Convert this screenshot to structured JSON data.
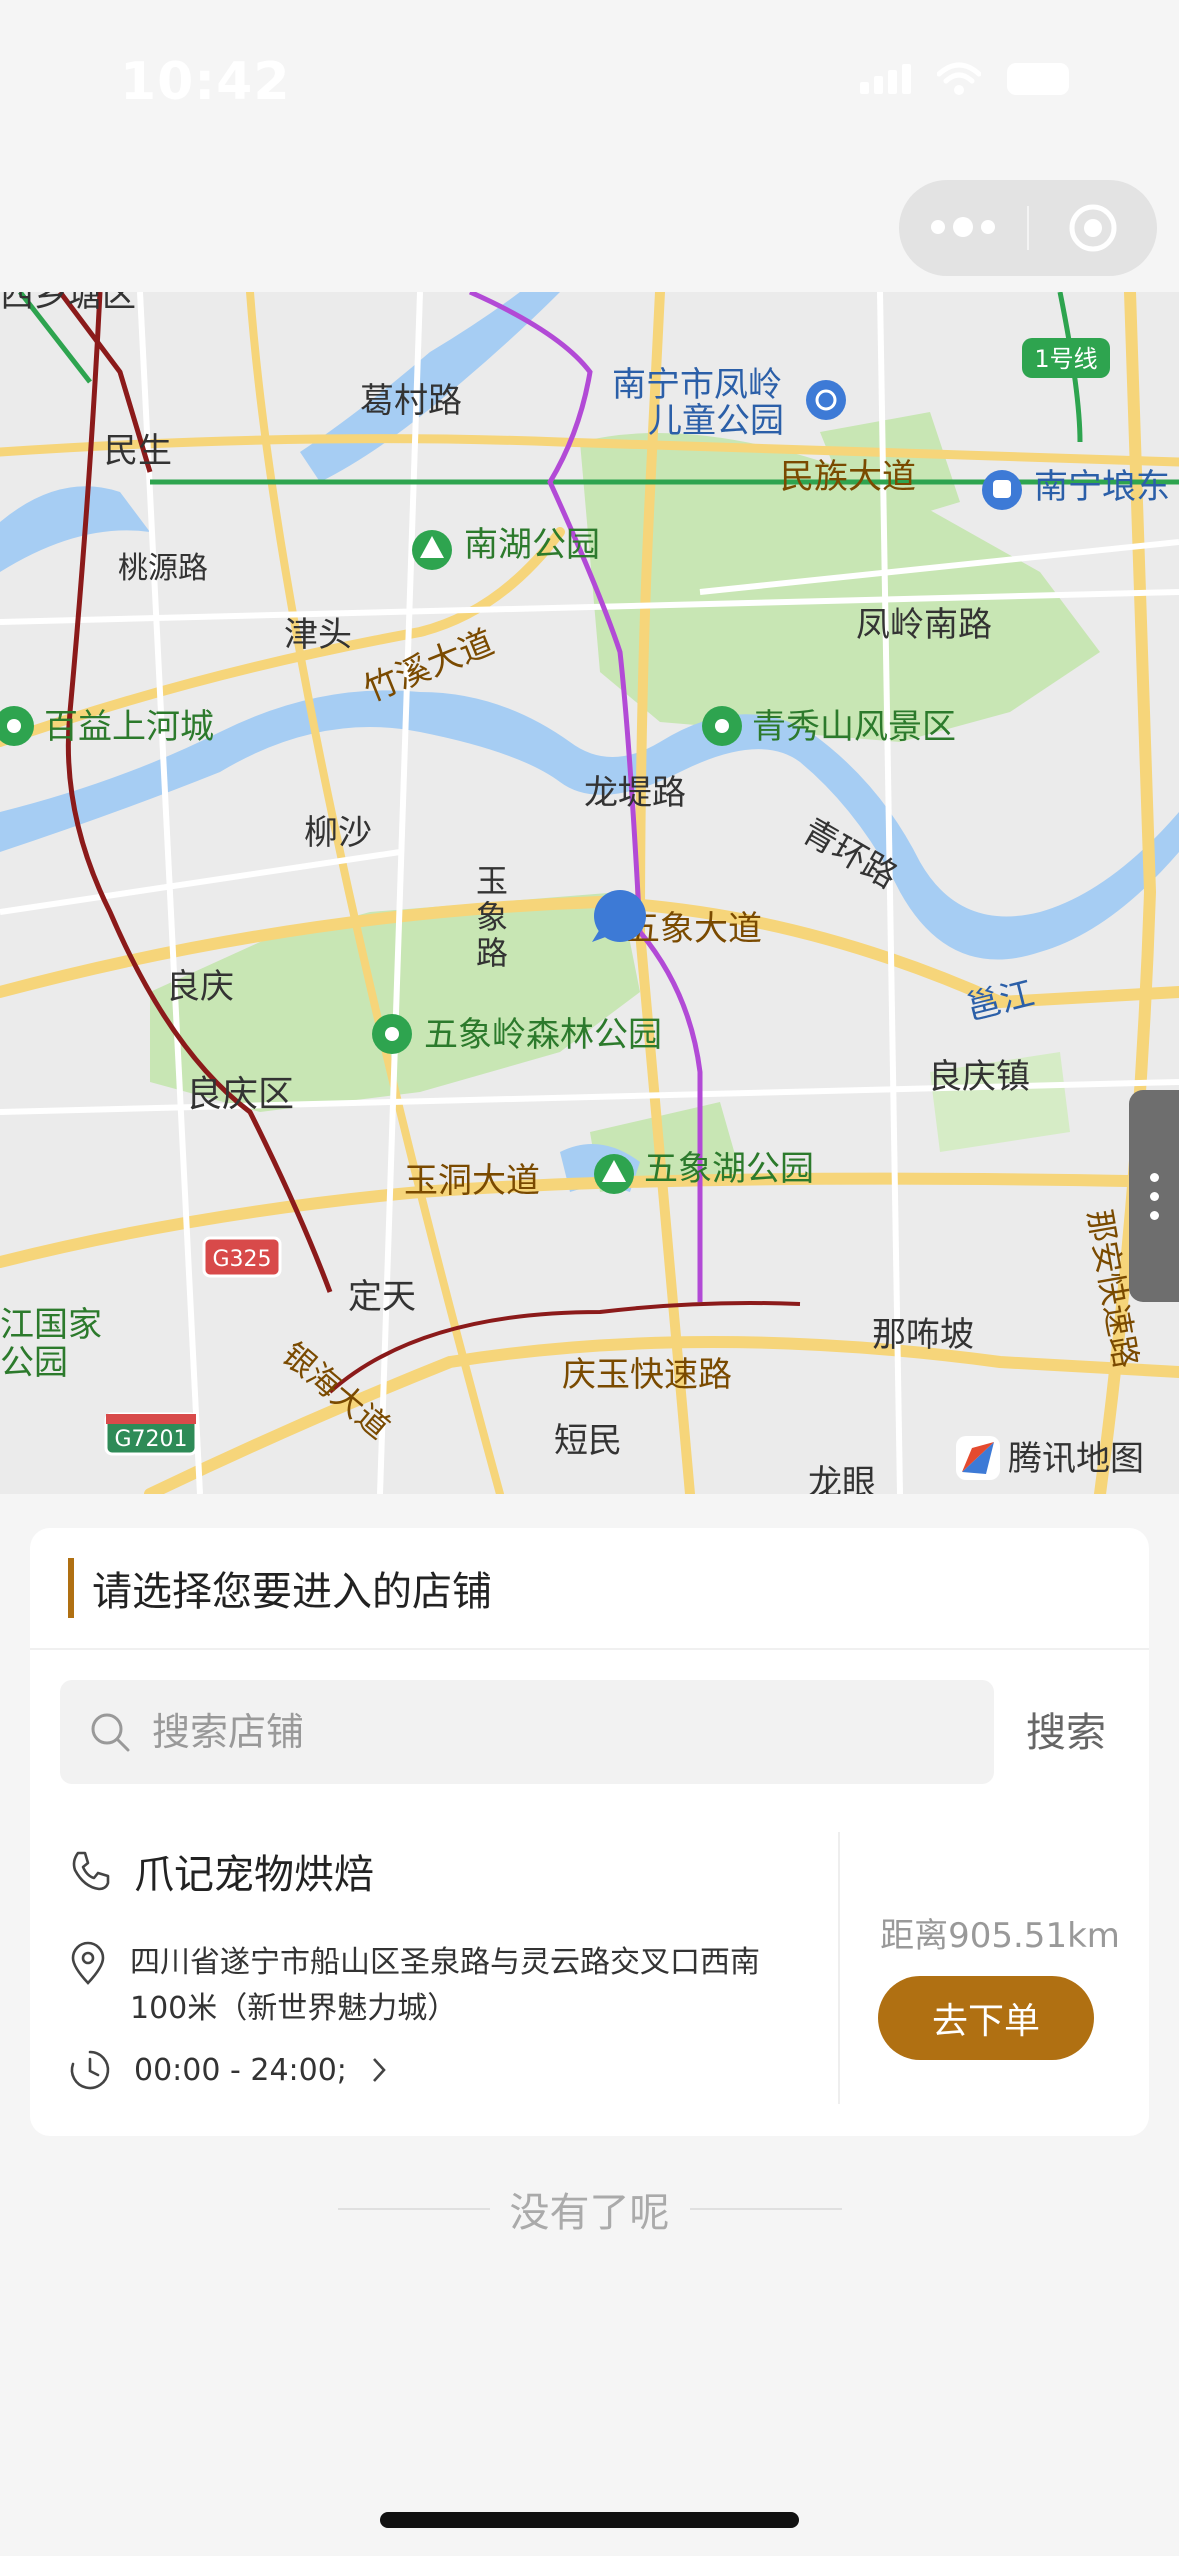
{
  "status_bar": {
    "time": "10:42"
  },
  "map": {
    "labels": {
      "gecun_road": "葛村路",
      "fengling_park": "南宁市凤岭",
      "fengling_park_2": "儿童公园",
      "line1": "1号线",
      "minsheng": "民生",
      "minzu_ave": "民族大道",
      "nanning_east": "南宁埌东",
      "taoyuan_road": "桃源路",
      "nanhu_park": "南湖公园",
      "jintou": "津头",
      "fengling_south": "凤岭南路",
      "zhuxi_ave": "竹溪大道",
      "baiyi": "百益上河城",
      "qingxiushan": "青秀山风景区",
      "longti_road": "龙堤路",
      "liusha": "柳沙",
      "qinghuan_road": "青环路",
      "wuxiang_road": "玉象路",
      "wuxiang_ave": "五象大道",
      "liangqing": "良庆",
      "yongjiang": "邕江",
      "wuxiangling": "五象岭森林公园",
      "liangqing_district": "良庆区",
      "liangqing_town": "良庆镇",
      "yudong_ave": "玉洞大道",
      "wuxianghu": "五象湖公园",
      "naan_expressway": "那安快速路",
      "g325": "G325",
      "dingtian": "定天",
      "naxipo": "那咘坡",
      "national_park": "江国家",
      "national_park_2": "公园",
      "yinhai_ave": "银海大道",
      "qingyu_expressway": "庆玉快速路",
      "g7201": "G7201",
      "duanmin": "短民",
      "longyan": "龙眼",
      "top_cut": "西乡塘区",
      "tencent_map": "腾讯地图"
    }
  },
  "card": {
    "title": "请选择您要进入的店铺",
    "search": {
      "placeholder": "搜索店铺",
      "button": "搜索"
    },
    "store": {
      "name": "爪记宠物烘焙",
      "address": "四川省遂宁市船山区圣泉路与灵云路交叉口西南100米（新世界魅力城）",
      "hours": "00:00 - 24:00;",
      "distance": "距离905.51km",
      "order_button": "去下单"
    }
  },
  "footer": {
    "no_more": "没有了呢"
  },
  "colors": {
    "accent": "#b07012",
    "map_water": "#a6cdf3",
    "map_park": "#c8e6b4",
    "metro_purple": "#b24ad6"
  }
}
